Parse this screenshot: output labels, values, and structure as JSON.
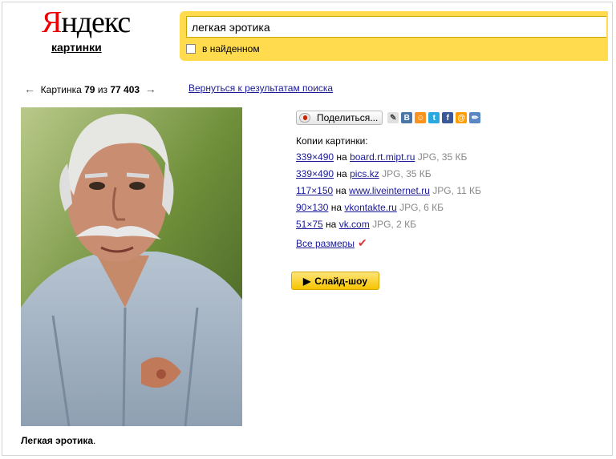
{
  "header": {
    "logo_first": "Я",
    "logo_rest": "ндекс",
    "service": "картинки",
    "search_value": "легкая эротика",
    "in_found_label": "в найденном"
  },
  "pager": {
    "prev_arrow": "←",
    "label": "Картинка",
    "current": "79",
    "of": "из",
    "total": "77 403",
    "next_arrow": "→",
    "back_link": "Вернуться к результатам поиска"
  },
  "image": {
    "caption_bold": "Легкая эротика",
    "caption_tail": "."
  },
  "share": {
    "button_label": "Поделиться...",
    "icons": [
      {
        "name": "lj-icon",
        "glyph": "✎",
        "color": "#e0e0e0"
      },
      {
        "name": "vkontakte-icon",
        "glyph": "B",
        "color": "#4a76a8"
      },
      {
        "name": "odnoklassniki-icon",
        "glyph": "☺",
        "color": "#f7931e"
      },
      {
        "name": "twitter-icon",
        "glyph": "t",
        "color": "#2aa9e0"
      },
      {
        "name": "facebook-icon",
        "glyph": "f",
        "color": "#3b5998"
      },
      {
        "name": "moimir-icon",
        "glyph": "@",
        "color": "#ff9e00"
      },
      {
        "name": "blog-pencil-icon",
        "glyph": "✏",
        "color": "#5b86c4"
      }
    ]
  },
  "copies": {
    "title": "Копии картинки:",
    "rows": [
      {
        "size": "339×490",
        "on": "на",
        "site": "board.rt.mipt.ru",
        "meta": "JPG, 35 КБ"
      },
      {
        "size": "339×490",
        "on": "на",
        "site": "pics.kz",
        "meta": "JPG, 35 КБ"
      },
      {
        "size": "117×150",
        "on": "на",
        "site": "www.liveinternet.ru",
        "meta": "JPG, 11 КБ"
      },
      {
        "size": "90×130",
        "on": "на",
        "site": "vkontakte.ru",
        "meta": "JPG, 6 КБ"
      },
      {
        "size": "51×75",
        "on": "на",
        "site": "vk.com",
        "meta": "JPG, 2 КБ"
      }
    ],
    "all_sizes": "Все размеры"
  },
  "slideshow": {
    "icon": "▶",
    "label": "Слайд-шоу"
  }
}
